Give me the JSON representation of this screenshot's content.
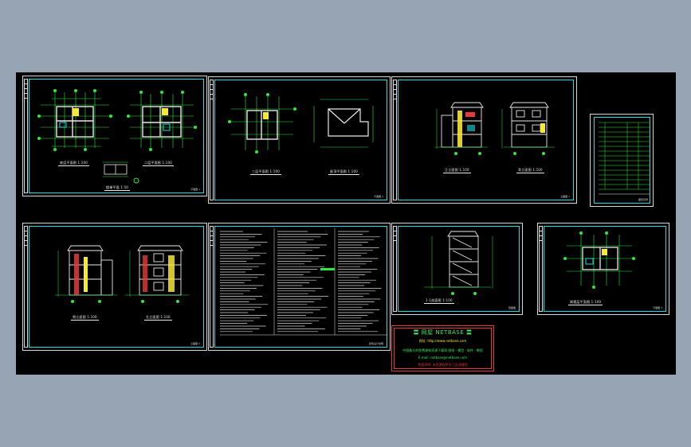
{
  "sheets": [
    {
      "id": "sheet-1",
      "captions": [
        "底层平面图 1:100",
        "二层平面图 1:100",
        "楼梯平面 1:50"
      ],
      "title": "平面图 1"
    },
    {
      "id": "sheet-2",
      "captions": [
        "三层平面图 1:100",
        "屋顶平面图 1:100"
      ],
      "title": "平面图 2"
    },
    {
      "id": "sheet-3",
      "captions": [
        "正立面图 1:100",
        "背立面图 1:100"
      ],
      "title": "立面图 1"
    },
    {
      "id": "sheet-4",
      "captions": [
        "侧立面图 1:100",
        "左立面图 1:100"
      ],
      "title": "立面图 2"
    },
    {
      "id": "sheet-5",
      "captions": [],
      "title": "建筑设计说明"
    },
    {
      "id": "sheet-6",
      "captions": [
        "1-1剖面图 1:100"
      ],
      "title": "剖面图"
    },
    {
      "id": "sheet-7",
      "captions": [
        "阁楼层平面图 1:100"
      ],
      "title": "平面图 3"
    },
    {
      "id": "sheet-8",
      "captions": [],
      "title": "图纸目录"
    }
  ],
  "netbase": {
    "title": "〓 网屋 NETBASE 〓",
    "line1": "网址: http://www.netbase.com",
    "line2": "中国最大的免费建筑资源下载网 图纸 · 模型 · 软件 · 教程",
    "line3": "E-mail: netbase@netbase.com",
    "line4": "免责声明: 本资源仅供学习交流使用"
  },
  "colors": {
    "background": "#96a4b4",
    "canvas": "#000000",
    "frame": "#19e0e8",
    "lines": "#2ee83a",
    "walls": "#e8e8e8",
    "accent": "#f7e834",
    "red": "#e83a3a"
  }
}
